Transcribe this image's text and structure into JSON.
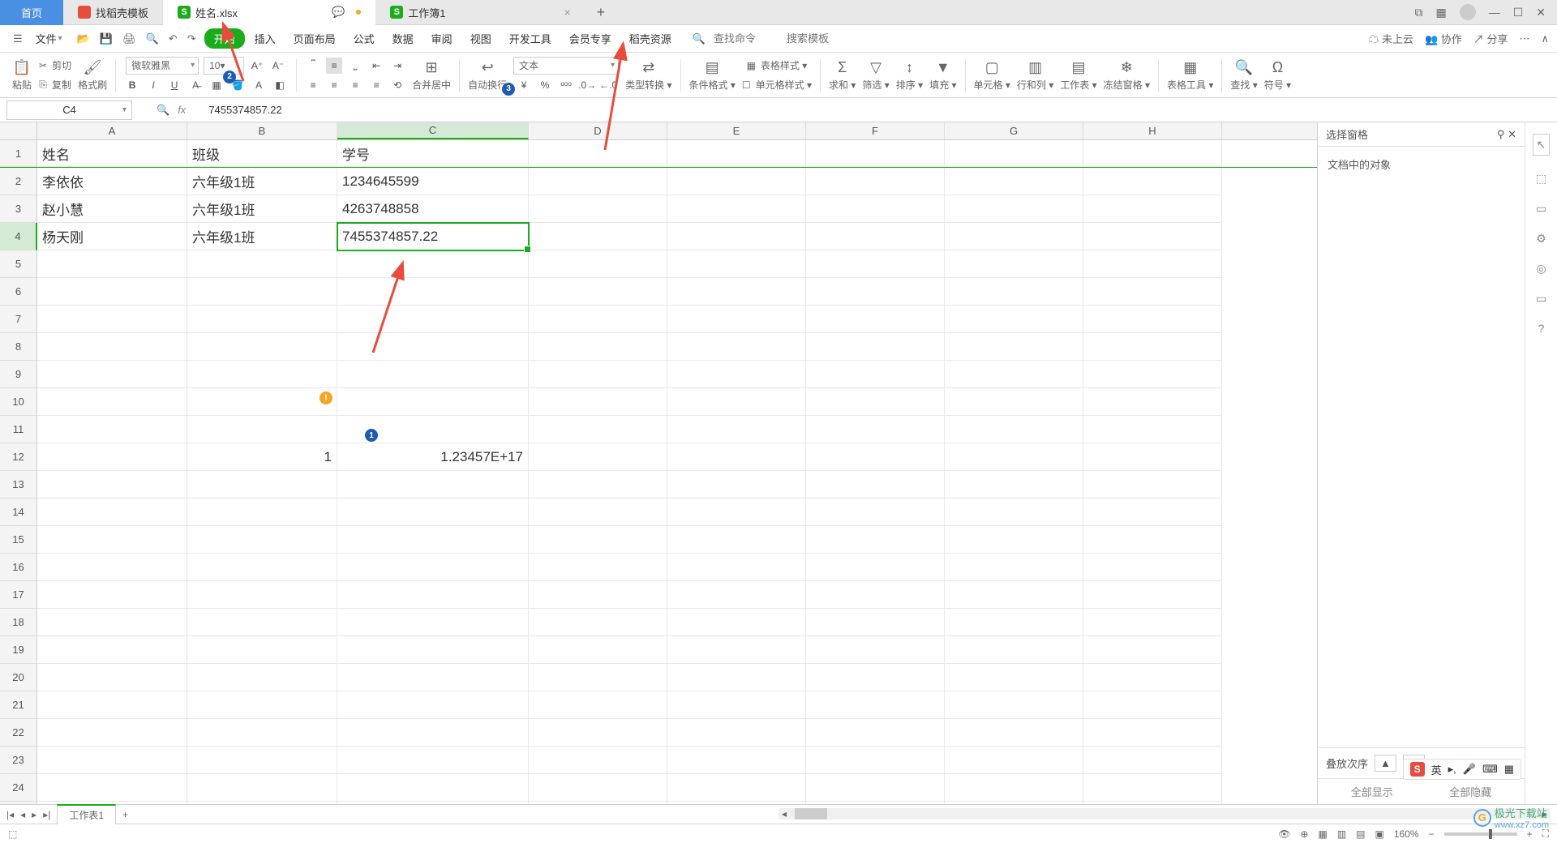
{
  "titlebar": {
    "home": "首页",
    "tab1": "找稻壳模板",
    "tab2": "姓名.xlsx",
    "tab3": "工作簿1"
  },
  "menubar": {
    "file": "文件",
    "start": "开始",
    "items": [
      "插入",
      "页面布局",
      "公式",
      "数据",
      "审阅",
      "视图",
      "开发工具",
      "会员专享",
      "稻壳资源"
    ],
    "search_cmd_ph": "查找命令",
    "search_tpl_ph": "搜索模板",
    "cloud": "未上云",
    "coop": "协作",
    "share": "分享"
  },
  "ribbon": {
    "paste": "粘贴",
    "cut": "剪切",
    "copy": "复制",
    "format_painter": "格式刷",
    "font_name": "微软雅黑",
    "font_size": "10",
    "merge": "合并居中",
    "autowrap": "自动换行",
    "numfmt": "文本",
    "typeconv": "类型转换",
    "condfmt": "条件格式",
    "tablestyle": "表格样式",
    "cellstyle": "单元格样式",
    "sum": "求和",
    "filter": "筛选",
    "sort": "排序",
    "fill": "填充",
    "cell": "单元格",
    "rowcol": "行和列",
    "worksheet": "工作表",
    "freeze": "冻结窗格",
    "tabletool": "表格工具",
    "find": "查找",
    "symbol": "符号"
  },
  "formula": {
    "cellref": "C4",
    "value": "7455374857.22"
  },
  "columns": [
    "A",
    "B",
    "C",
    "D",
    "E",
    "F",
    "G",
    "H"
  ],
  "headers": {
    "A": "姓名",
    "B": "班级",
    "C": "学号"
  },
  "rows": [
    {
      "A": "李依依",
      "B": "六年级1班",
      "C": "1234645599"
    },
    {
      "A": "赵小慧",
      "B": "六年级1班",
      "C": "4263748858"
    },
    {
      "A": "杨天刚",
      "B": "六年级1班",
      "C": "7455374857.22"
    }
  ],
  "extra": {
    "B12": "1",
    "C12": "1.23457E+17"
  },
  "sidepanel": {
    "title": "选择窗格",
    "body": "文档中的对象",
    "order": "叠放次序",
    "showall": "全部显示",
    "hideall": "全部隐藏"
  },
  "sheettab": "工作表1",
  "status": {
    "zoom": "160%"
  },
  "badges": {
    "b1": "1",
    "b2": "2",
    "b3": "3"
  },
  "watermark": {
    "name": "极光下载站",
    "url": "www.xz7.com"
  },
  "ime": "英"
}
